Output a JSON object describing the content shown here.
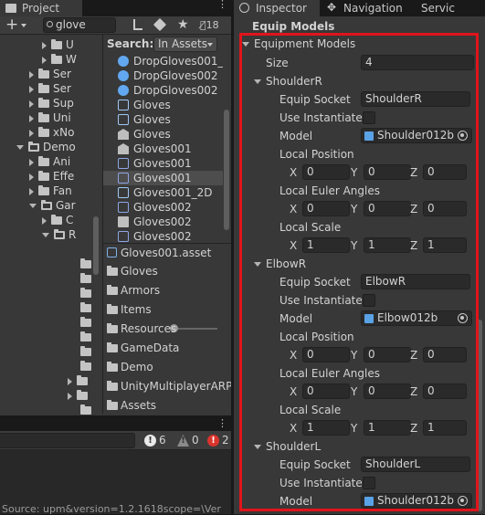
{
  "project": {
    "tab_label": "Project",
    "search_text": "glove",
    "hidden_count": "18",
    "tree": [
      {
        "label": "U",
        "indent": 2,
        "open": false
      },
      {
        "label": "W",
        "indent": 2,
        "open": false
      },
      {
        "label": "Ser",
        "indent": 1,
        "open": false
      },
      {
        "label": "Ser",
        "indent": 1,
        "open": false
      },
      {
        "label": "Sup",
        "indent": 1,
        "open": false
      },
      {
        "label": "Uni",
        "indent": 1,
        "open": false
      },
      {
        "label": "xNo",
        "indent": 1,
        "open": false
      },
      {
        "label": "Demo",
        "indent": 0,
        "open": true
      },
      {
        "label": "Ani",
        "indent": 1,
        "open": false
      },
      {
        "label": "Effe",
        "indent": 1,
        "open": false
      },
      {
        "label": "Fan",
        "indent": 1,
        "open": false
      },
      {
        "label": "Gar",
        "indent": 1,
        "open": true
      },
      {
        "label": "C",
        "indent": 2,
        "open": false
      },
      {
        "label": "R",
        "indent": 2,
        "open": true
      }
    ],
    "search_label": "Search:",
    "search_scope": "In Assets",
    "results": [
      {
        "label": "DropGloves001_2",
        "icon": "prefab-icon"
      },
      {
        "label": "DropGloves002",
        "icon": "prefab-icon"
      },
      {
        "label": "DropGloves002",
        "icon": "prefab-icon"
      },
      {
        "label": "Gloves",
        "icon": "prefab-variant-icon"
      },
      {
        "label": "Gloves",
        "icon": "prefab-variant-icon"
      },
      {
        "label": "Gloves",
        "icon": "model-icon"
      },
      {
        "label": "Gloves001",
        "icon": "model-icon"
      },
      {
        "label": "Gloves001",
        "icon": "mesh-icon"
      },
      {
        "label": "Gloves001",
        "icon": "mesh-icon",
        "selected": true
      },
      {
        "label": "Gloves001_2D",
        "icon": "prefab-variant-icon"
      },
      {
        "label": "Gloves002",
        "icon": "mesh-icon"
      },
      {
        "label": "Gloves002",
        "icon": "texture-icon"
      },
      {
        "label": "Gloves002",
        "icon": "mesh-icon"
      }
    ],
    "selected_asset": "Gloves001.asset",
    "path_items": [
      "Gloves",
      "Armors",
      "Items",
      "Resources",
      "GameData",
      "Demo",
      "UnityMultiplayerARPG",
      "Assets"
    ]
  },
  "console": {
    "search_value": "",
    "info_count": "6",
    "warning_count": "0",
    "error_count": "2",
    "status_text": "Source: upm&version=1.2.1618scope=\\Ver"
  },
  "inspector": {
    "tabs": {
      "inspector": "Inspector",
      "navigation": "Navigation",
      "services": "Servic"
    },
    "section_label": "Equip Models",
    "group_label": "Equipment Models",
    "size_label": "Size",
    "size_value": "4",
    "elements": [
      {
        "name": "ShoulderR",
        "equip_socket_label": "Equip Socket",
        "equip_socket": "ShoulderR",
        "use_instantiated_label": "Use Instantiatec",
        "model_label": "Model",
        "model": "Shoulder012b",
        "local_position_label": "Local Position",
        "local_position": {
          "x": "0",
          "y": "0",
          "z": "0"
        },
        "local_euler_label": "Local Euler Angles",
        "local_euler": {
          "x": "0",
          "y": "0",
          "z": "0"
        },
        "local_scale_label": "Local Scale",
        "local_scale": {
          "x": "1",
          "y": "1",
          "z": "1"
        }
      },
      {
        "name": "ElbowR",
        "equip_socket_label": "Equip Socket",
        "equip_socket": "ElbowR",
        "use_instantiated_label": "Use Instantiatec",
        "model_label": "Model",
        "model": "Elbow012b",
        "local_position_label": "Local Position",
        "local_position": {
          "x": "0",
          "y": "0",
          "z": "0"
        },
        "local_euler_label": "Local Euler Angles",
        "local_euler": {
          "x": "0",
          "y": "0",
          "z": "0"
        },
        "local_scale_label": "Local Scale",
        "local_scale": {
          "x": "1",
          "y": "1",
          "z": "1"
        }
      },
      {
        "name": "ShoulderL",
        "equip_socket_label": "Equip Socket",
        "equip_socket": "ShoulderL",
        "use_instantiated_label": "Use Instantiatec",
        "model_label": "Model",
        "model": "Shoulder012b"
      }
    ],
    "axis": {
      "x": "X",
      "y": "Y",
      "z": "Z"
    }
  },
  "colors": {
    "highlight_box": "#e0141c",
    "panel": "#383838",
    "field": "#2a2a2a"
  }
}
